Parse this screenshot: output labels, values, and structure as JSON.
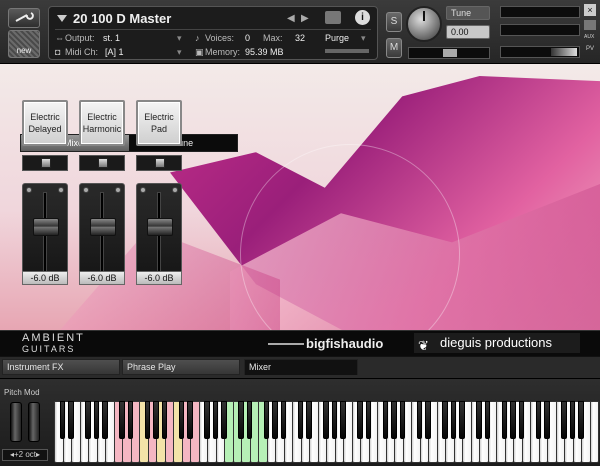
{
  "header": {
    "instrument_name": "20 100 D Master",
    "output_label": "Output:",
    "output_value": "st. 1",
    "midi_label": "Midi Ch:",
    "midi_value": "[A]  1",
    "voices_label": "Voices:",
    "voices_value": "0",
    "max_label": "Max:",
    "max_value": "32",
    "memory_label": "Memory:",
    "memory_value": "95.39 MB",
    "purge_label": "Purge",
    "new_label": "new",
    "solo_label": "S",
    "mute_label": "M",
    "tune_label": "Tune",
    "tune_value": "0.00",
    "info_label": "i",
    "aux_label": "AUX",
    "pv_label": "PV"
  },
  "mixer": {
    "tabs": [
      {
        "label": "Mixer",
        "active": true
      },
      {
        "label": "Tune",
        "active": false
      }
    ],
    "channels": [
      {
        "name_line1": "Electric",
        "name_line2": "Delayed",
        "volume": "-6.0 dB"
      },
      {
        "name_line1": "Electric",
        "name_line2": "Harmonic",
        "volume": "-6.0 dB"
      },
      {
        "name_line1": "Electric",
        "name_line2": "Pad",
        "volume": "-6.0 dB"
      }
    ]
  },
  "branding": {
    "product_line1": "AMBIENT",
    "product_line2": "GUITARS",
    "vendor": "bigfishaudio",
    "developer": "dieguis productions"
  },
  "lower_tabs": [
    {
      "label": "Instrument FX",
      "active": false
    },
    {
      "label": "Phrase Play",
      "active": false
    },
    {
      "label": "Mixer",
      "active": true
    }
  ],
  "keyboard": {
    "pitch_mod_label": "Pitch Mod",
    "octave_label": "+2 oct",
    "colors": {
      "keyswitch": "#f4b6c2",
      "keyswitch_alt": "#f3e3a8",
      "playable": "#b6f0b6"
    }
  },
  "colors": {
    "accent": "#c32f8a",
    "panel": "#1c1c1c"
  }
}
